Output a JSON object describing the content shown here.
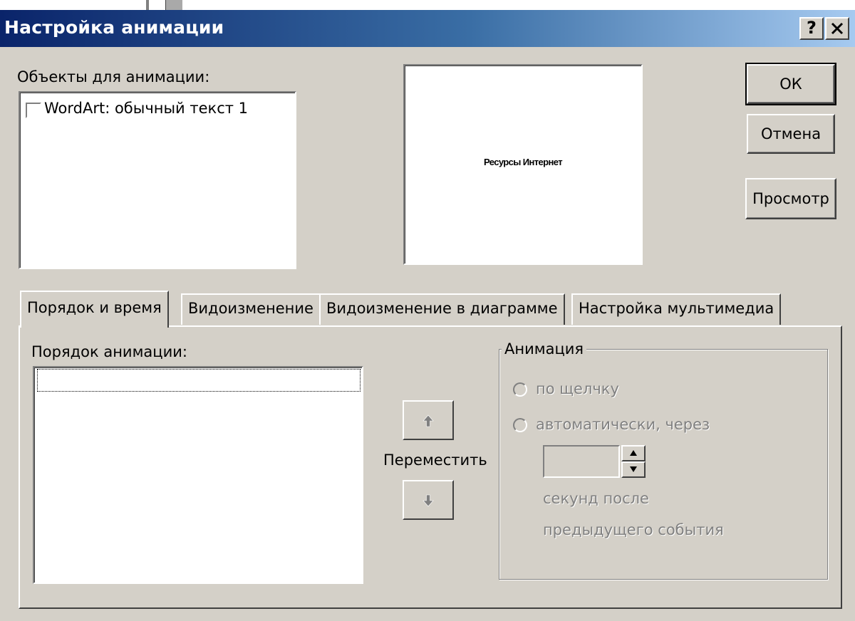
{
  "window": {
    "title": "Настройка анимации",
    "help_button": "?",
    "close_button": "✕"
  },
  "objects_panel": {
    "label": "Объекты для анимации:",
    "items": [
      {
        "label": "WordArt: обычный текст 1",
        "checked": false
      }
    ]
  },
  "preview": {
    "text": "Ресурсы Интернет"
  },
  "buttons": {
    "ok": "ОК",
    "cancel": "Отмена",
    "preview": "Просмотр"
  },
  "tabs": [
    {
      "label": "Порядок и время",
      "active": true
    },
    {
      "label": "Видоизменение",
      "active": false
    },
    {
      "label": "Видоизменение в диаграмме",
      "active": false
    },
    {
      "label": "Настройка мультимедиа",
      "active": false
    }
  ],
  "order_tab": {
    "order_label": "Порядок анимации:",
    "move_label": "Переместить",
    "move_up_icon": "arrow-up-icon",
    "move_down_icon": "arrow-down-icon",
    "animation_group": {
      "title": "Анимация",
      "on_click_label": "по щелчку",
      "auto_label": "автоматически, через",
      "seconds_value": "",
      "after_line1": "секунд после",
      "after_line2": "предыдущего события",
      "enabled": false
    }
  },
  "colors": {
    "dialog_face": "#d4d0c8",
    "titlebar_start": "#0a246a",
    "titlebar_end": "#a6caf0",
    "disabled_text": "#808080"
  }
}
